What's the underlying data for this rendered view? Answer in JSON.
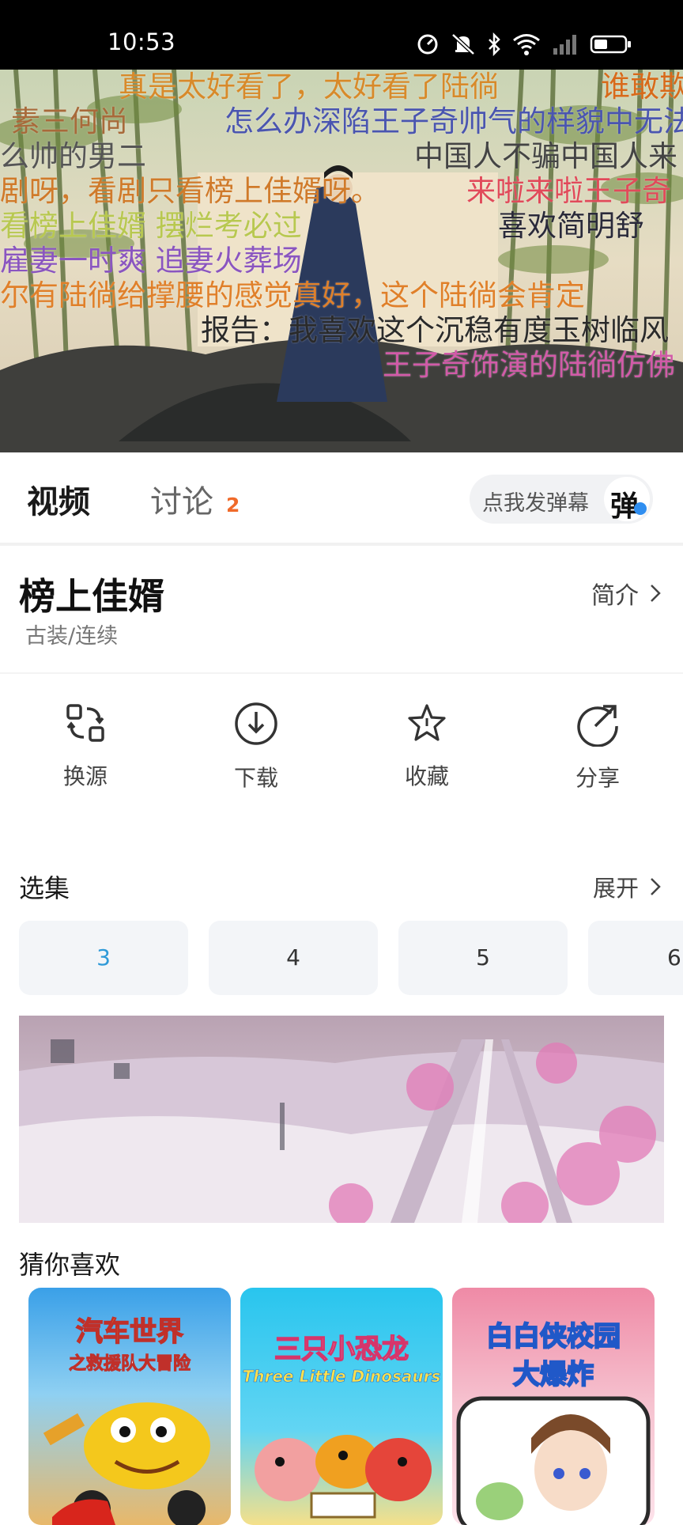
{
  "status_bar": {
    "time": "10:53",
    "icons": [
      "alarm-gauge-icon",
      "mute-icon",
      "bluetooth-icon",
      "wifi-icon",
      "signal-icon",
      "battery-icon"
    ]
  },
  "player": {
    "danmaku": [
      "真是太好看了，太好看了陆徜",
      "谁敢欺",
      "素三何尚",
      "怎么办深陷王子奇帅气的样貌中无法",
      "么帅的男二",
      "中国人不骗中国人来",
      "剧呀，看剧只看榜上佳婿呀。",
      "来啦来啦王子奇",
      "看榜上佳婿 摆烂考必过",
      "喜欢简明舒",
      "雇妻一时爽 追妻火葬场",
      "尔有陆徜给撑腰的感觉真好，这个陆徜会肯定",
      "报告：我喜欢这个沉稳有度玉树临风",
      "王子奇饰演的陆徜仿佛"
    ]
  },
  "tabs": {
    "video": "视频",
    "discuss": "讨论",
    "discuss_count": "2",
    "danmu_placeholder": "点我发弹幕",
    "danmu_icon_text": "弹"
  },
  "show": {
    "title": "榜上佳婿",
    "genre": "古装/连续",
    "intro_label": "简介"
  },
  "actions": [
    {
      "label": "换源",
      "icon": "switch-source-icon"
    },
    {
      "label": "下载",
      "icon": "download-icon"
    },
    {
      "label": "收藏",
      "icon": "star-icon"
    },
    {
      "label": "分享",
      "icon": "share-icon"
    }
  ],
  "episodes": {
    "title": "选集",
    "expand_label": "展开",
    "items": [
      "3",
      "4",
      "5",
      "6"
    ],
    "selected": "3"
  },
  "recommend": {
    "title": "猜你喜欢",
    "cards": [
      {
        "title_line1": "汽车世界",
        "title_line2": "之救援队大冒险"
      },
      {
        "title_line1": "三只小恐龙",
        "title_line2": "Three Little Dinosaurs"
      },
      {
        "title_line1": "白白侠校园",
        "title_line2": "大爆炸"
      }
    ]
  },
  "colors": {
    "accent_blue": "#2f9ad8",
    "badge_orange": "#f06a2a",
    "episode_bg": "#f3f5f8"
  }
}
